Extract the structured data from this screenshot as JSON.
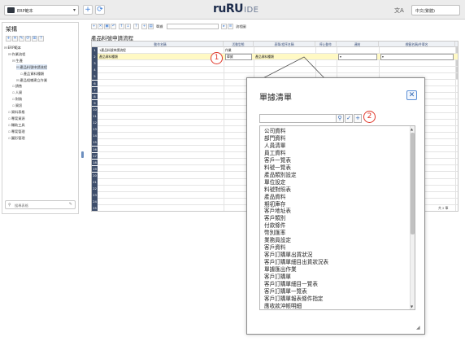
{
  "topbar": {
    "app_select": "ERP範本",
    "add_button": "+",
    "refresh_button": "⟳",
    "brand_main": "ruRU",
    "brand_suffix": "IDE",
    "lang_icon": "文A",
    "lang_select": "中文(繁體)"
  },
  "left_panel": {
    "title": "架構",
    "toolbar": [
      "+",
      "✕",
      "✎",
      "⟳",
      "⊞",
      "?"
    ],
    "tree": [
      {
        "label": "ERP範本",
        "toggle": "−",
        "level": 0,
        "selected": false
      },
      {
        "label": "作業流程",
        "toggle": "−",
        "level": 1,
        "selected": false
      },
      {
        "label": "生產",
        "toggle": "−",
        "level": 2,
        "selected": false
      },
      {
        "label": "產品料號申請流程",
        "toggle": "−",
        "level": 3,
        "selected": true
      },
      {
        "label": "產品資料種類",
        "toggle": "",
        "level": 4,
        "selected": false
      },
      {
        "label": "產品組織建立作業",
        "toggle": "−",
        "level": 3,
        "selected": false
      },
      {
        "label": "銷售",
        "toggle": "",
        "level": 2,
        "selected": false
      },
      {
        "label": "人資",
        "toggle": "",
        "level": 2,
        "selected": false
      },
      {
        "label": "財務",
        "toggle": "",
        "level": 2,
        "selected": false
      },
      {
        "label": "資訊",
        "toggle": "",
        "level": 2,
        "selected": false
      },
      {
        "label": "資料表格",
        "toggle": "",
        "level": 1,
        "selected": false
      },
      {
        "label": "專案資源",
        "toggle": "",
        "level": 1,
        "selected": false
      },
      {
        "label": "輔助工具",
        "toggle": "",
        "level": 1,
        "selected": false
      },
      {
        "label": "專案管理",
        "toggle": "",
        "level": 1,
        "selected": false
      },
      {
        "label": "圖形管理",
        "toggle": "",
        "level": 1,
        "selected": false
      }
    ],
    "search_placeholder": "搜尋表格",
    "search_icon": "search-icon",
    "clear_icon": "edit-icon"
  },
  "main": {
    "title": "產品料號申請流程",
    "toolbar_label": "單據",
    "toolbar_label2": "流程圖",
    "columns": [
      "動作名稱",
      "活動型態",
      "表單/程序名稱",
      "停止動作",
      "連結",
      "標籤名稱/件單名"
    ],
    "rows": [
      {
        "num": "1",
        "name": "1產品料號申請流程",
        "type": "作業",
        "form": "",
        "link": "",
        "label": "",
        "active": false
      },
      {
        "num": "2",
        "name": "產品資料種類",
        "type": "單據",
        "form": "產品資料種類",
        "link": "▾",
        "label": "▾",
        "active": true
      }
    ],
    "row_count": 25,
    "footer": "共 2 筆"
  },
  "markers": {
    "one": "1",
    "two": "2"
  },
  "popup": {
    "title": "單據清單",
    "close": "✕",
    "search_value": "",
    "search_icon": "search-icon",
    "confirm_icon": "check-icon",
    "add_icon": "plus-icon",
    "items": [
      "公司資料",
      "部門資料",
      "人員清單",
      "員工資料",
      "客戶一覽表",
      "料號一覽表",
      "產品類別設定",
      "單位設定",
      "料號對照表",
      "產品資料",
      "期初庫存",
      "客戶地址表",
      "客戶類別",
      "付款條件",
      "幣別匯率",
      "業務員設定",
      "客戶資料",
      "客戶訂購單出貨狀況",
      "客戶訂購單細目出貨狀況表",
      "單據匯出作業",
      "客戶訂購單",
      "客戶訂購單細目一覽表",
      "客戶訂購單一覽表",
      "客戶訂購單報表條件指定",
      "應收款沖帳明細"
    ]
  },
  "colors": {
    "accent": "#3a7bd5",
    "marker": "#e0382b",
    "row_header": "#3e4e6b",
    "active_row": "#fff9c4"
  }
}
